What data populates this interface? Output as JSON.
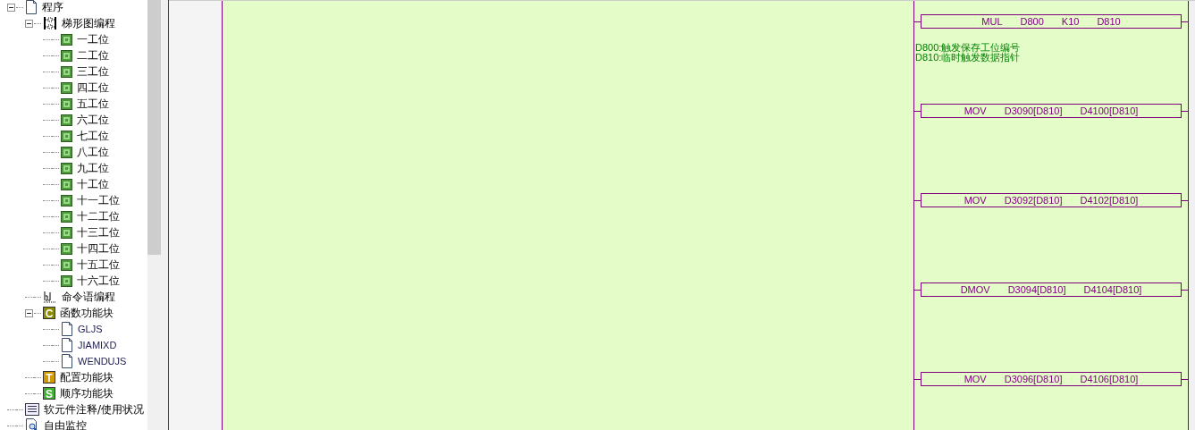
{
  "tree": [
    {
      "label": "程序",
      "kind": "doc",
      "expanded": true,
      "children": [
        {
          "label": "梯形图编程",
          "kind": "ladder",
          "expanded": true,
          "children": [
            {
              "label": "一工位",
              "kind": "step"
            },
            {
              "label": "二工位",
              "kind": "step"
            },
            {
              "label": "三工位",
              "kind": "step"
            },
            {
              "label": "四工位",
              "kind": "step"
            },
            {
              "label": "五工位",
              "kind": "step"
            },
            {
              "label": "六工位",
              "kind": "step"
            },
            {
              "label": "七工位",
              "kind": "step"
            },
            {
              "label": "八工位",
              "kind": "step"
            },
            {
              "label": "九工位",
              "kind": "step"
            },
            {
              "label": "十工位",
              "kind": "step"
            },
            {
              "label": "十一工位",
              "kind": "step"
            },
            {
              "label": "十二工位",
              "kind": "step"
            },
            {
              "label": "十三工位",
              "kind": "step"
            },
            {
              "label": "十四工位",
              "kind": "step"
            },
            {
              "label": "十五工位",
              "kind": "step"
            },
            {
              "label": "十六工位",
              "kind": "step"
            }
          ]
        },
        {
          "label": "命令语编程",
          "kind": "code"
        },
        {
          "label": "函数功能块",
          "kind": "badge",
          "badge": "C",
          "color": "#8c8c00",
          "expanded": true,
          "children": [
            {
              "label": "GLJS",
              "kind": "doc"
            },
            {
              "label": "JIAMIXD",
              "kind": "doc"
            },
            {
              "label": "WENDUJS",
              "kind": "doc"
            }
          ]
        },
        {
          "label": "配置功能块",
          "kind": "badge",
          "badge": "T",
          "color": "#d39b00"
        },
        {
          "label": "顺序功能块",
          "kind": "badge",
          "badge": "S",
          "color": "#3fb030"
        }
      ]
    },
    {
      "label": "软元件注释/使用状况",
      "kind": "list"
    },
    {
      "label": "自由监控",
      "kind": "monitor"
    }
  ],
  "ladder": {
    "rungs": [
      {
        "op": "MUL",
        "args": [
          "D800",
          "K10",
          "D810"
        ],
        "comments": [
          "D800:触发保存工位编号",
          "D810:临时触发数据指针"
        ]
      },
      {
        "op": "MOV",
        "args": [
          "D3090[D810]",
          "D4100[D810]"
        ]
      },
      {
        "op": "MOV",
        "args": [
          "D3092[D810]",
          "D4102[D810]"
        ]
      },
      {
        "op": "DMOV",
        "args": [
          "D3094[D810]",
          "D4104[D810]"
        ]
      },
      {
        "op": "MOV",
        "args": [
          "D3096[D810]",
          "D4106[D810]"
        ]
      }
    ]
  }
}
